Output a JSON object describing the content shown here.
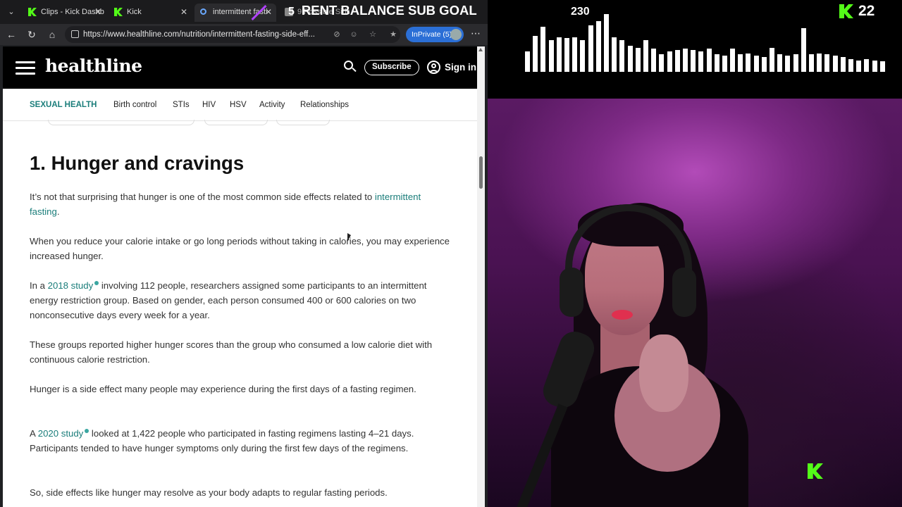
{
  "browser": {
    "tabs": [
      {
        "title": "Clips - Kick Dashb",
        "favicon": "kick-icon"
      },
      {
        "title": "Kick",
        "favicon": "kick-icon"
      },
      {
        "title": "intermittent fasti",
        "favicon": "search-icon"
      },
      {
        "title": "9 Possible Side",
        "favicon": "page-icon"
      }
    ],
    "url": "https://www.healthline.com/nutrition/intermittent-fasting-side-eff...",
    "inprivate_label": "InPrivate (5)"
  },
  "site": {
    "logo": "healthline",
    "subscribe": "Subscribe",
    "signin": "Sign in",
    "subnav": {
      "category": "SEXUAL HEALTH",
      "items": [
        "Birth control",
        "STIs",
        "HIV",
        "HSV",
        "Activity",
        "Relationships"
      ]
    }
  },
  "article": {
    "heading": "1. Hunger and cravings",
    "p1_before": "It’s not that surprising that hunger is one of the most common side effects related to ",
    "p1_link": "intermittent fasting",
    "p1_after": ".",
    "p2": "When you reduce your calorie intake or go long periods without taking in calories, you may experience increased hunger.",
    "p3_before": "In a ",
    "p3_link": "2018 study",
    "p3_after": " involving 112 people, researchers assigned some participants to an intermittent energy restriction group. Based on gender, each person consumed 400 or 600 calories on two nonconsecutive days every week for a year.",
    "p4": "These groups reported higher hunger scores than the group who consumed a low calorie diet with continuous calorie restriction.",
    "p5": "Hunger is a side effect many people may experience during the first days of a fasting regimen.",
    "p6_before": "A ",
    "p6_link": "2020 study",
    "p6_after": " looked at 1,422 people who participated in fasting regimens lasting 4–21 days. Participants tended to have hunger symptoms only during the first few days of the regimens.",
    "p7": "So, side effects like hunger may resolve as your body adapts to regular fasting periods."
  },
  "overlay": {
    "goal_number": "5",
    "goal_label": "RENT BALANCE SUB GOAL",
    "goal_value": "230",
    "kick_count": "22",
    "visualizer_levels": [
      0.35,
      0.62,
      0.78,
      0.55,
      0.6,
      0.58,
      0.6,
      0.55,
      0.8,
      0.88,
      1.0,
      0.6,
      0.55,
      0.45,
      0.42,
      0.55,
      0.4,
      0.3,
      0.35,
      0.38,
      0.4,
      0.38,
      0.35,
      0.4,
      0.3,
      0.28,
      0.4,
      0.3,
      0.32,
      0.28,
      0.25,
      0.42,
      0.3,
      0.28,
      0.3,
      0.76,
      0.3,
      0.32,
      0.3,
      0.28,
      0.25,
      0.22,
      0.2,
      0.22,
      0.2,
      0.18
    ],
    "accent": "#53fc18"
  }
}
